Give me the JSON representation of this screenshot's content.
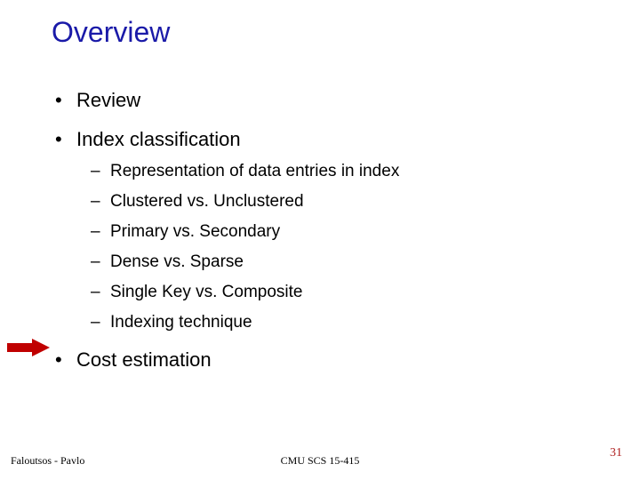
{
  "title": "Overview",
  "bullets": {
    "b0": "Review",
    "b1": "Index classification",
    "b1_sub": {
      "s0": "Representation of data entries in index",
      "s1": "Clustered vs. Unclustered",
      "s2": "Primary vs. Secondary",
      "s3": "Dense vs. Sparse",
      "s4": "Single Key vs. Composite",
      "s5": "Indexing technique"
    },
    "b2": "Cost estimation"
  },
  "footer": {
    "left": "Faloutsos - Pavlo",
    "center": "CMU SCS 15-415",
    "right": "31"
  },
  "colors": {
    "title": "#1a1aa8",
    "arrow": "#c00000",
    "pagenum": "#b02424"
  }
}
